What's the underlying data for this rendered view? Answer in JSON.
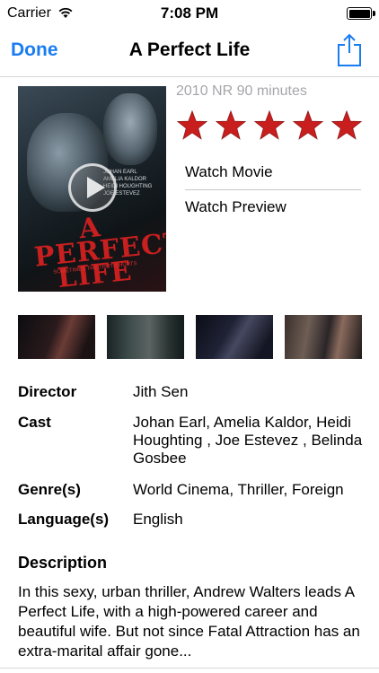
{
  "status": {
    "carrier": "Carrier",
    "time": "7:08 PM"
  },
  "nav": {
    "done_label": "Done",
    "title": "A Perfect Life"
  },
  "poster": {
    "title": "A PERFECT LIFE",
    "tagline": "SOMETIMES THE TRUTH HURTS",
    "credits": [
      "JOHAN EARL",
      "AMELIA KALDOR",
      "HEIDI HOUGHTING",
      "JOE ESTEVEZ"
    ]
  },
  "movie": {
    "meta": "2010 NR 90 minutes",
    "rating_stars": 5,
    "star_color": "#c81e1e"
  },
  "actions": {
    "watch_movie": "Watch Movie",
    "watch_preview": "Watch Preview"
  },
  "details": {
    "director_label": "Director",
    "director": "Jith Sen",
    "cast_label": "Cast",
    "cast": "Johan Earl, Amelia Kaldor, Heidi Houghting , Joe Estevez , Belinda Gosbee",
    "genre_label": "Genre(s)",
    "genre": "World Cinema, Thriller, Foreign",
    "language_label": "Language(s)",
    "language": "English"
  },
  "description": {
    "heading": "Description",
    "text": "In this sexy, urban thriller, Andrew Walters leads A Perfect Life, with a high-powered career and beautiful wife. But not since Fatal Attraction has an extra-marital affair gone..."
  },
  "colors": {
    "accent": "#1a7cf2"
  }
}
